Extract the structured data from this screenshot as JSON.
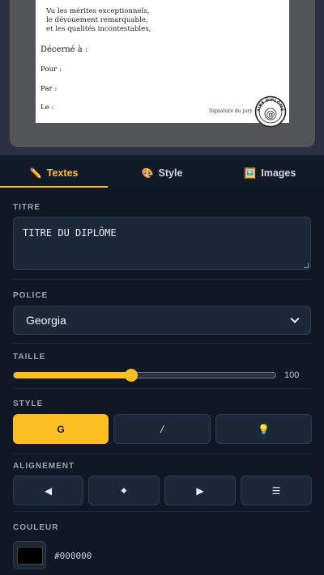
{
  "preview": {
    "merit_lines": [
      "Vu les mérites exceptionnels,",
      "le dévouement remarquable,",
      "et les qualités incontestables,"
    ],
    "decerne": "Décerné à :",
    "fields": [
      "Pour :",
      "Par :",
      "Le :"
    ],
    "signature": "Signature du jury",
    "seal_text": "FAIRE DIPLÔMES",
    "seal_icon": "at-icon"
  },
  "tabs": [
    {
      "label": "Textes",
      "icon": "pencil-icon",
      "glyph": "✏️",
      "active": true
    },
    {
      "label": "Style",
      "icon": "palette-icon",
      "glyph": "🎨",
      "active": false
    },
    {
      "label": "Images",
      "icon": "picture-icon",
      "glyph": "🖼️",
      "active": false
    }
  ],
  "titre": {
    "label": "TITRE",
    "value": "TITRE DU DIPLÔME"
  },
  "police": {
    "label": "POLICE",
    "value": "Georgia"
  },
  "taille": {
    "label": "TAILLE",
    "value": "100",
    "fraction": 0.45
  },
  "style": {
    "label": "STYLE",
    "bold": "G",
    "italic": "/",
    "light_glyph": "💡",
    "light_icon": "lightbulb-icon"
  },
  "alignement": {
    "label": "ALIGNEMENT",
    "buttons": [
      {
        "glyph": "◀",
        "icon": "align-left-icon"
      },
      {
        "glyph": "◆",
        "icon": "align-center-icon"
      },
      {
        "glyph": "▶",
        "icon": "align-right-icon"
      },
      {
        "glyph": "☰",
        "icon": "justify-icon"
      }
    ]
  },
  "couleur": {
    "label": "COULEUR",
    "value": "#000000"
  },
  "colors": {
    "accent": "#fbbf24",
    "panel_bg": "#0f1824",
    "field_bg": "#1b2838"
  }
}
